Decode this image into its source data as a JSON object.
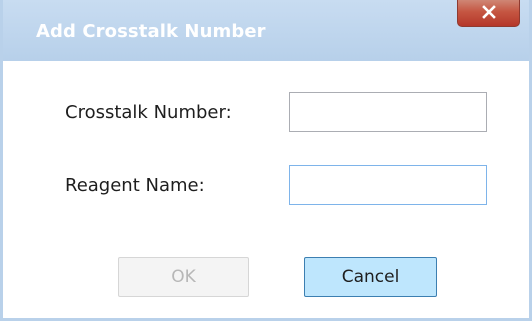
{
  "dialog": {
    "title": "Add Crosstalk Number",
    "close_label": "x"
  },
  "form": {
    "crosstalk_label": "Crosstalk Number:",
    "crosstalk_value": "",
    "reagent_label": "Reagent Name:",
    "reagent_value": ""
  },
  "buttons": {
    "ok_label": "OK",
    "ok_enabled": false,
    "cancel_label": "Cancel"
  },
  "colors": {
    "titlebar": "#b7d0ea",
    "close_button": "#c55642",
    "focused_input_border": "#7eb4ea",
    "cancel_button_bg": "#bee6fd"
  }
}
